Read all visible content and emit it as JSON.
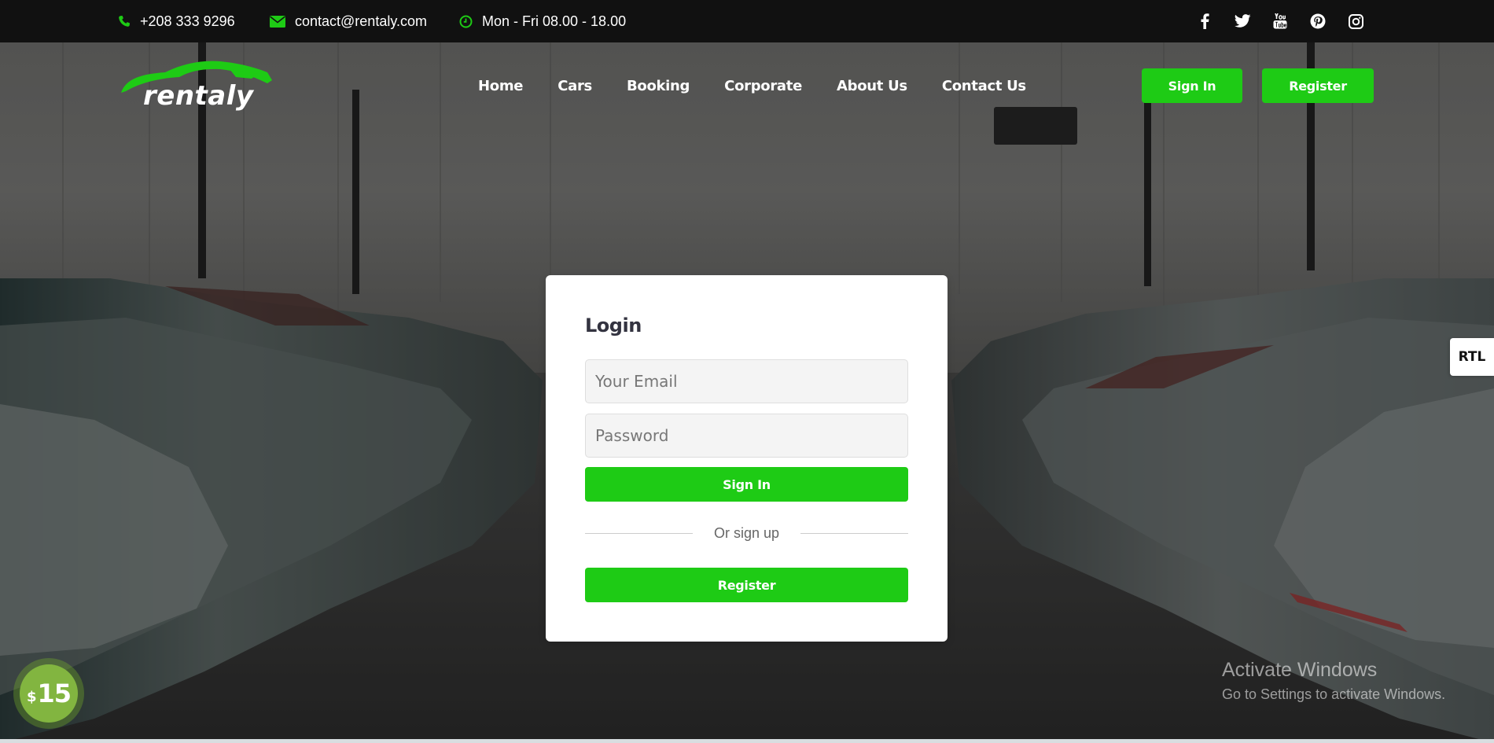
{
  "topbar": {
    "phone": "+208 333 9296",
    "email": "contact@rentaly.com",
    "hours": "Mon - Fri 08.00 - 18.00",
    "social_icons": [
      "facebook-icon",
      "twitter-icon",
      "youtube-icon",
      "pinterest-icon",
      "instagram-icon"
    ]
  },
  "header": {
    "logo_text": "rentaly",
    "nav": [
      "Home",
      "Cars",
      "Booking",
      "Corporate",
      "About Us",
      "Contact Us"
    ],
    "signin_label": "Sign In",
    "register_label": "Register"
  },
  "login": {
    "title": "Login",
    "email_placeholder": "Your Email",
    "password_placeholder": "Password",
    "signin_label": "Sign In",
    "divider_text": "Or sign up",
    "register_label": "Register"
  },
  "rtl_label": "RTL",
  "price_badge": {
    "currency": "$",
    "amount": "15"
  },
  "watermark": {
    "line1": "Activate Windows",
    "line2": "Go to Settings to activate Windows."
  },
  "colors": {
    "accent": "#1ecb15",
    "topbar": "#111111",
    "badge": "#82b540"
  }
}
